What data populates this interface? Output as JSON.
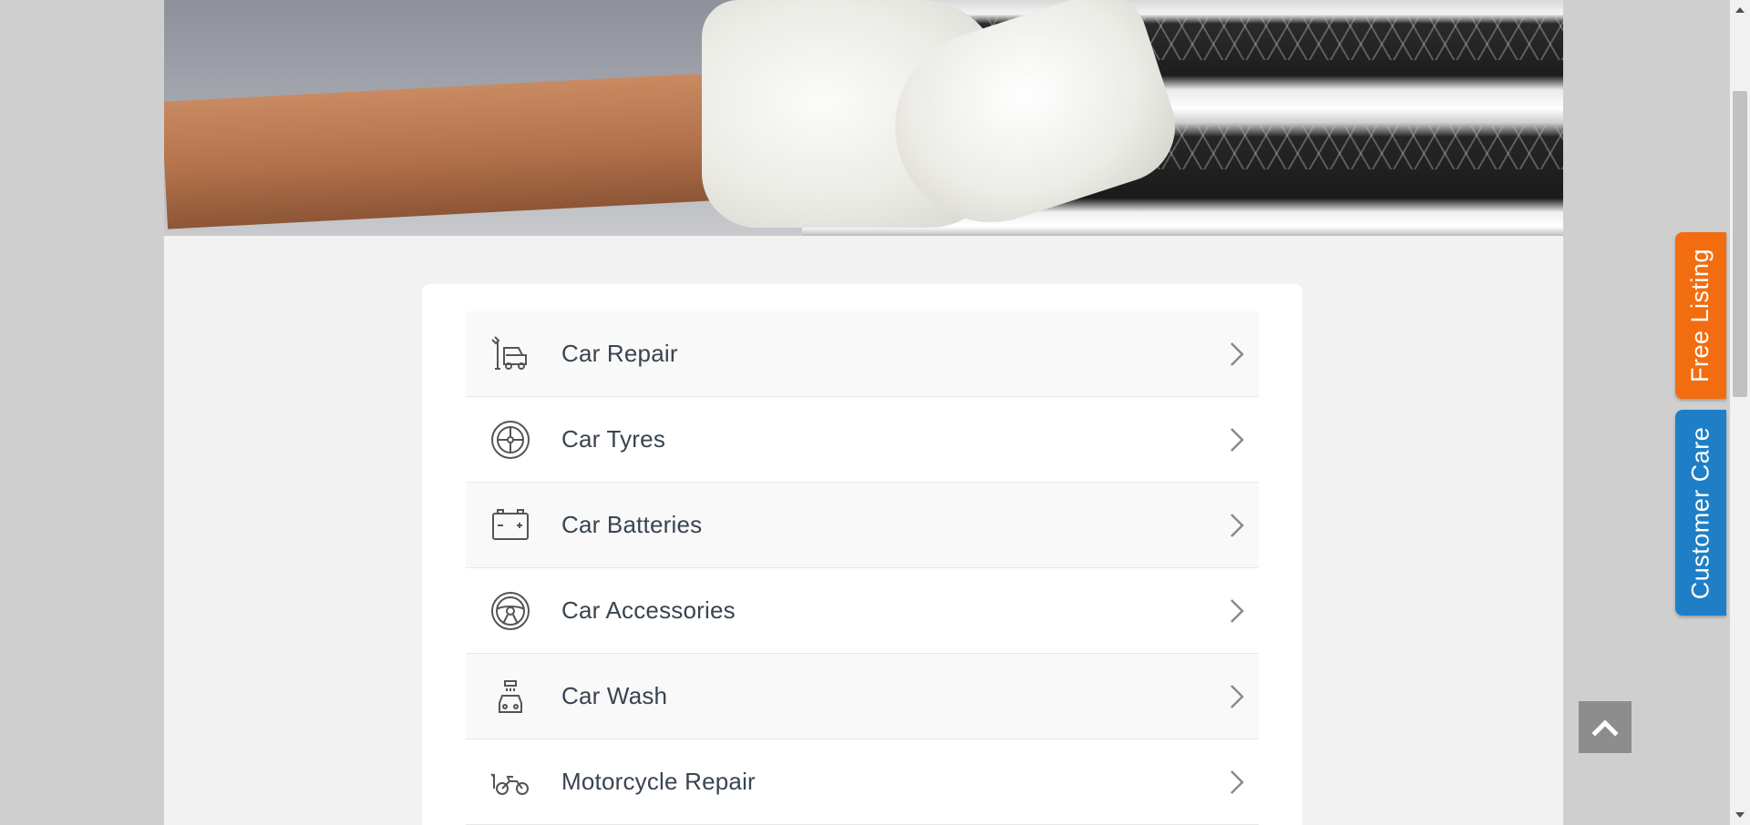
{
  "categories": [
    {
      "label": "Car Repair",
      "icon": "car-repair-icon"
    },
    {
      "label": "Car Tyres",
      "icon": "tyre-icon"
    },
    {
      "label": "Car Batteries",
      "icon": "battery-icon"
    },
    {
      "label": "Car Accessories",
      "icon": "steering-wheel-icon"
    },
    {
      "label": "Car Wash",
      "icon": "car-wash-icon"
    },
    {
      "label": "Motorcycle Repair",
      "icon": "motorcycle-repair-icon"
    }
  ],
  "side_tabs": {
    "free_listing": "Free Listing",
    "customer_care": "Customer Care"
  },
  "colors": {
    "free_listing": "#f26d0f",
    "customer_care": "#1f7fc6",
    "label_text": "#3a4450"
  }
}
